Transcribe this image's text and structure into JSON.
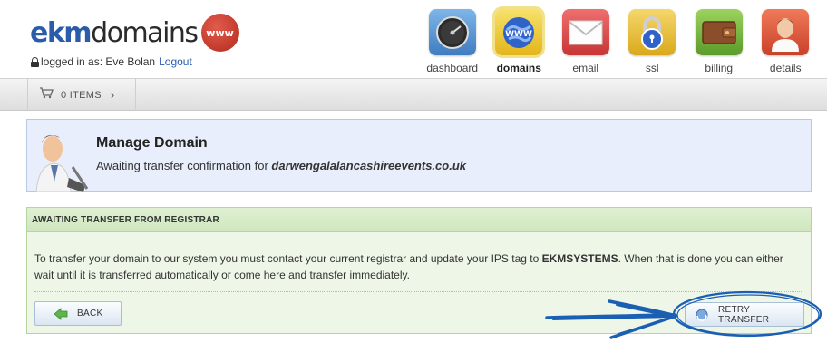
{
  "header": {
    "logo": {
      "part1": "ekm",
      "part2": "domains",
      "badge": "www"
    },
    "login": {
      "text": "logged in as: Eve Bolan",
      "logout_label": "Logout"
    }
  },
  "nav": {
    "items": [
      {
        "label": "dashboard",
        "icon": "dashboard-gauge-icon",
        "active": false
      },
      {
        "label": "domains",
        "icon": "globe-www-icon",
        "active": true
      },
      {
        "label": "email",
        "icon": "envelope-icon",
        "active": false
      },
      {
        "label": "ssl",
        "icon": "padlock-icon",
        "active": false
      },
      {
        "label": "billing",
        "icon": "wallet-icon",
        "active": false
      },
      {
        "label": "details",
        "icon": "person-icon",
        "active": false
      }
    ]
  },
  "toolbar": {
    "cart_label": "0 ITEMS",
    "cart_icon": "cart-icon",
    "chevron": "›"
  },
  "manage": {
    "title": "Manage Domain",
    "subtitle_prefix": "Awaiting transfer confirmation for ",
    "domain": "darwengalalancashireevents.co.uk"
  },
  "transfer": {
    "header": "AWAITING TRANSFER FROM REGISTRAR",
    "body_part1": "To transfer your domain to our system you must contact your current registrar and update your IPS tag to ",
    "body_tag": "EKMSYSTEMS",
    "body_part2": ". When that is done you can either wait until it is transferred automatically or come here and transfer immediately.",
    "back_label": "BACK",
    "retry_label": "RETRY TRANSFER"
  },
  "colors": {
    "brand_blue": "#2a5caa",
    "info_panel_bg": "#e8eefb",
    "success_panel_bg": "#eef6e8",
    "annotation_blue": "#1a5fb4"
  }
}
